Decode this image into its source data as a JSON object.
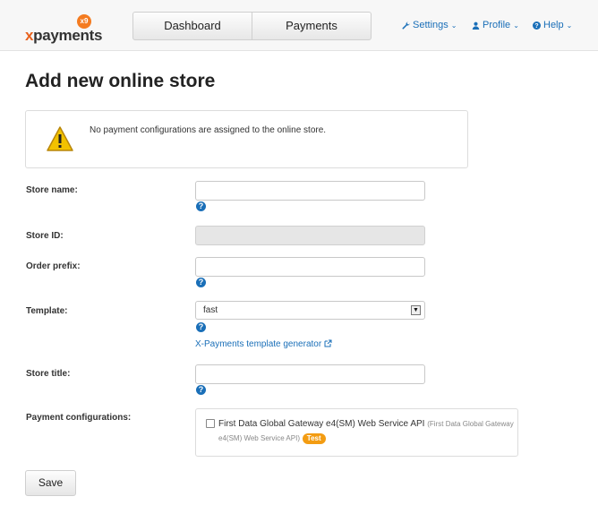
{
  "brand": {
    "logo_text": "payments",
    "logo_prefix": "x",
    "logo_badge": "x9",
    "color": "#e8611d"
  },
  "topnav": {
    "tabs": [
      {
        "label": "Dashboard"
      },
      {
        "label": "Payments"
      }
    ]
  },
  "menus": {
    "settings": {
      "label": "Settings",
      "icon": "wrench-icon"
    },
    "profile": {
      "label": "Profile",
      "icon": "user-icon"
    },
    "help": {
      "label": "Help",
      "icon": "question-circle-icon"
    }
  },
  "page": {
    "title": "Add new online store"
  },
  "alert": {
    "text": "No payment configurations are assigned to the online store.",
    "icon": "warning-icon"
  },
  "form": {
    "store_name": {
      "label": "Store name:",
      "value": ""
    },
    "store_id": {
      "label": "Store ID:",
      "value": ""
    },
    "order_prefix": {
      "label": "Order prefix:",
      "value": ""
    },
    "template": {
      "label": "Template:",
      "selected": "fast",
      "generator_link": "X-Payments template generator"
    },
    "store_title": {
      "label": "Store title:",
      "value": ""
    },
    "payment_configurations": {
      "label": "Payment configurations:",
      "items": [
        {
          "name": "First Data Global Gateway e4(SM) Web Service API",
          "sub": "(First Data Global Gateway e4(SM) Web Service API)",
          "badge": "Test",
          "checked": false
        }
      ]
    },
    "help_glyph": "?"
  },
  "actions": {
    "save_label": "Save"
  },
  "colors": {
    "link": "#1a6fb8",
    "badge": "#f39c12"
  }
}
